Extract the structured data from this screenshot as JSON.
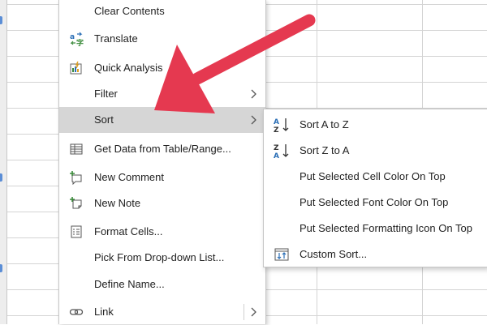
{
  "context_menu": {
    "items": [
      {
        "label": "Clear Contents",
        "icon": "clear-icon"
      },
      {
        "label": "Translate",
        "icon": "translate-icon"
      },
      {
        "label": "Quick Analysis",
        "icon": "quick-analysis-icon"
      },
      {
        "label": "Filter",
        "icon": "",
        "has_submenu": true
      },
      {
        "label": "Sort",
        "icon": "",
        "has_submenu": true,
        "highlighted": true
      },
      {
        "label": "Get Data from Table/Range...",
        "icon": "table-icon"
      },
      {
        "label": "New Comment",
        "icon": "new-comment-icon"
      },
      {
        "label": "New Note",
        "icon": "new-note-icon"
      },
      {
        "label": "Format Cells...",
        "icon": "format-cells-icon"
      },
      {
        "label": "Pick From Drop-down List...",
        "icon": ""
      },
      {
        "label": "Define Name...",
        "icon": ""
      },
      {
        "label": "Link",
        "icon": "link-icon",
        "has_submenu": true
      }
    ]
  },
  "sort_submenu": {
    "items": [
      {
        "label": "Sort A to Z",
        "icon": "sort-a-to-z-icon"
      },
      {
        "label": "Sort Z to A",
        "icon": "sort-z-to-a-icon"
      },
      {
        "label": "Put Selected Cell Color On Top",
        "icon": ""
      },
      {
        "label": "Put Selected Font Color On Top",
        "icon": ""
      },
      {
        "label": "Put Selected Formatting Icon On Top",
        "icon": ""
      },
      {
        "label": "Custom Sort...",
        "icon": "custom-sort-icon"
      }
    ]
  },
  "annotation": {
    "arrow_color": "#e53950"
  },
  "colors": {
    "highlight": "#d6d6d6",
    "icon_blue": "#2b6fb6",
    "icon_green": "#3a8a3a"
  }
}
